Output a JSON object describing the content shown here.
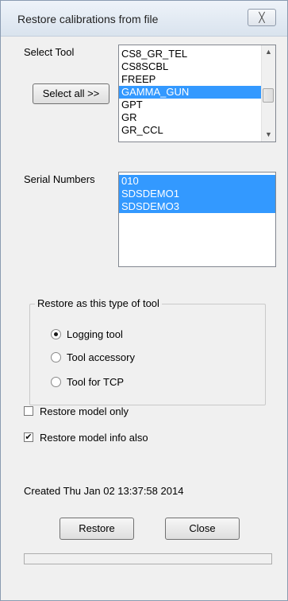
{
  "window": {
    "title": "Restore calibrations from file",
    "close_glyph": "╳"
  },
  "select_tool": {
    "label": "Select Tool",
    "select_all_label": "Select all >>",
    "items": [
      "CS8_GR_TEL",
      "CS8SCBL",
      "FREEP",
      "GAMMA_GUN",
      "GPT",
      "GR",
      "GR_CCL"
    ],
    "selected": [
      "GAMMA_GUN"
    ]
  },
  "serial_numbers": {
    "label": "Serial Numbers",
    "items": [
      "010",
      "SDSDEMO1",
      "SDSDEMO3"
    ],
    "selected": [
      "010",
      "SDSDEMO1",
      "SDSDEMO3"
    ]
  },
  "tool_type": {
    "legend": "Restore as this type of tool",
    "options": [
      "Logging tool",
      "Tool accessory",
      "Tool for TCP"
    ],
    "selected": "Logging tool"
  },
  "checks": {
    "model_only": {
      "label": "Restore model only",
      "checked": false
    },
    "model_info": {
      "label": "Restore model info also",
      "checked": true,
      "mark": "✔"
    }
  },
  "created_text": "Created Thu Jan 02 13:37:58 2014",
  "buttons": {
    "restore": "Restore",
    "close": "Close"
  },
  "progress": {
    "value": 0
  },
  "colors": {
    "selection": "#3399ff",
    "progress": "#06b025"
  }
}
